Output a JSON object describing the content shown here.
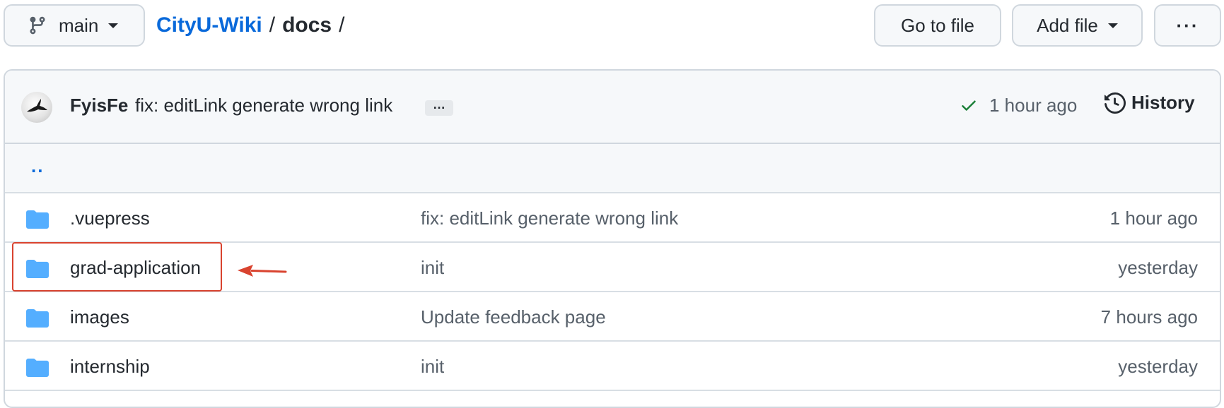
{
  "toolbar": {
    "branch_label": "main",
    "goto_label": "Go to file",
    "addfile_label": "Add file",
    "more_label": "···"
  },
  "breadcrumb": {
    "repo": "CityU-Wiki",
    "sep1": "/",
    "dir": "docs",
    "sep2": "/"
  },
  "commit": {
    "author": "FyisFe",
    "message": "fix: editLink generate wrong link",
    "ellipsis": "…",
    "time": "1 hour ago",
    "history_label": "History",
    "status_color": "#1a7f37"
  },
  "files": {
    "parent": "..",
    "rows": [
      {
        "name": ".vuepress",
        "message": "fix: editLink generate wrong link",
        "time": "1 hour ago"
      },
      {
        "name": "grad-application",
        "message": "init",
        "time": "yesterday"
      },
      {
        "name": "images",
        "message": "Update feedback page",
        "time": "7 hours ago"
      },
      {
        "name": "internship",
        "message": "init",
        "time": "yesterday"
      }
    ]
  },
  "colors": {
    "link": "#0969da",
    "folder": "#54aeff",
    "annotation": "#d9432f"
  },
  "icons": {
    "branch": "git-branch-icon",
    "check": "check-icon",
    "history": "history-icon",
    "folder": "folder-icon",
    "annotation_arrow": "arrow-left-icon"
  }
}
